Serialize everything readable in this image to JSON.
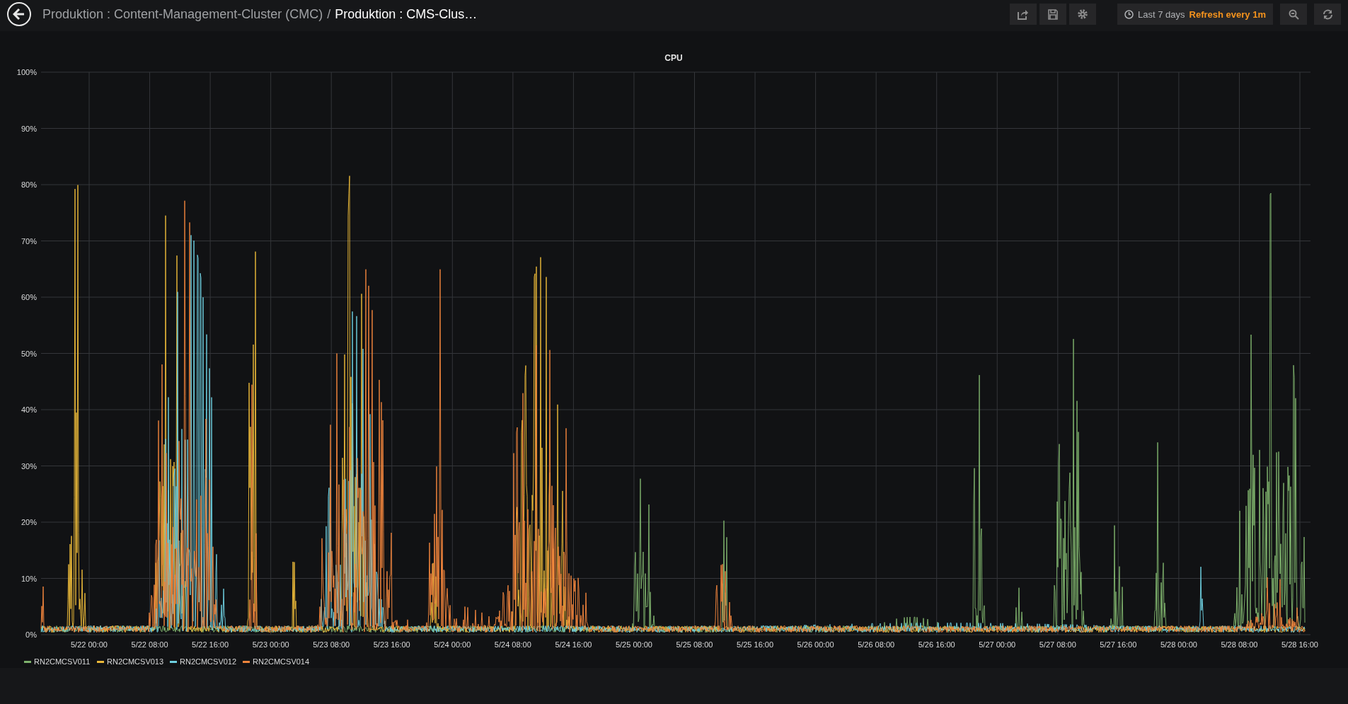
{
  "header": {
    "breadcrumb_parent": "Produktion : Content-Management-Cluster (CMC)",
    "separator": "/",
    "breadcrumb_current": "Produktion : CMS-Clus…"
  },
  "time_picker": {
    "range": "Last 7 days",
    "refresh": "Refresh every 1m"
  },
  "panel": {
    "title": "CPU",
    "y_labels": [
      "100%",
      "90%",
      "80%",
      "70%",
      "60%",
      "50%",
      "40%",
      "30%",
      "20%",
      "10%",
      "0%"
    ],
    "x_labels": [
      "5/22 00:00",
      "5/22 08:00",
      "5/22 16:00",
      "5/23 00:00",
      "5/23 08:00",
      "5/23 16:00",
      "5/24 00:00",
      "5/24 08:00",
      "5/24 16:00",
      "5/25 00:00",
      "5/25 08:00",
      "5/25 16:00",
      "5/26 00:00",
      "5/26 08:00",
      "5/26 16:00",
      "5/27 00:00",
      "5/27 08:00",
      "5/27 16:00",
      "5/28 00:00",
      "5/28 08:00",
      "5/28 16:00"
    ],
    "legend": [
      {
        "name": "RN2CMCSV011",
        "color": "#7eb26d"
      },
      {
        "name": "RN2CMCSV013",
        "color": "#eab839"
      },
      {
        "name": "RN2CMCSV012",
        "color": "#6ed0e0"
      },
      {
        "name": "RN2CMCSV014",
        "color": "#ef843c"
      }
    ]
  }
}
